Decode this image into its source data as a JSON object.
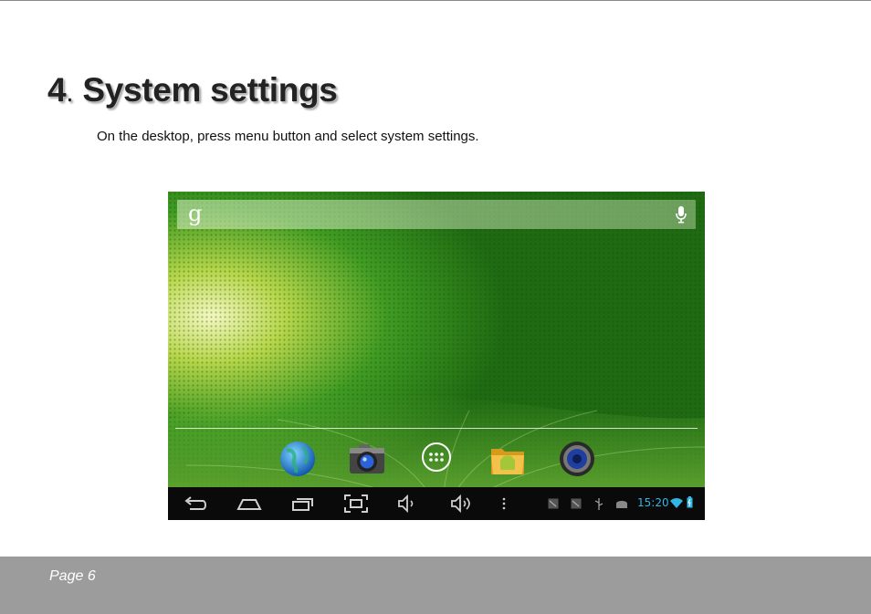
{
  "document": {
    "heading_number": "4",
    "heading_dot": ".",
    "heading_title": "System settings",
    "intro": "On the desktop, press menu button and select system settings."
  },
  "screenshot": {
    "search_logo": "g",
    "status_time": "15:20",
    "dock_icons": [
      "globe-icon",
      "camera-icon",
      "app-drawer-icon",
      "file-manager-icon",
      "speaker-icon"
    ],
    "nav_icons": [
      "back-icon",
      "home-icon",
      "recent-apps-icon",
      "screenshot-icon",
      "volume-down-icon",
      "volume-up-icon",
      "menu-icon"
    ],
    "accent_color": "#33b5e5"
  },
  "footer": {
    "page_label": "Page 6"
  }
}
